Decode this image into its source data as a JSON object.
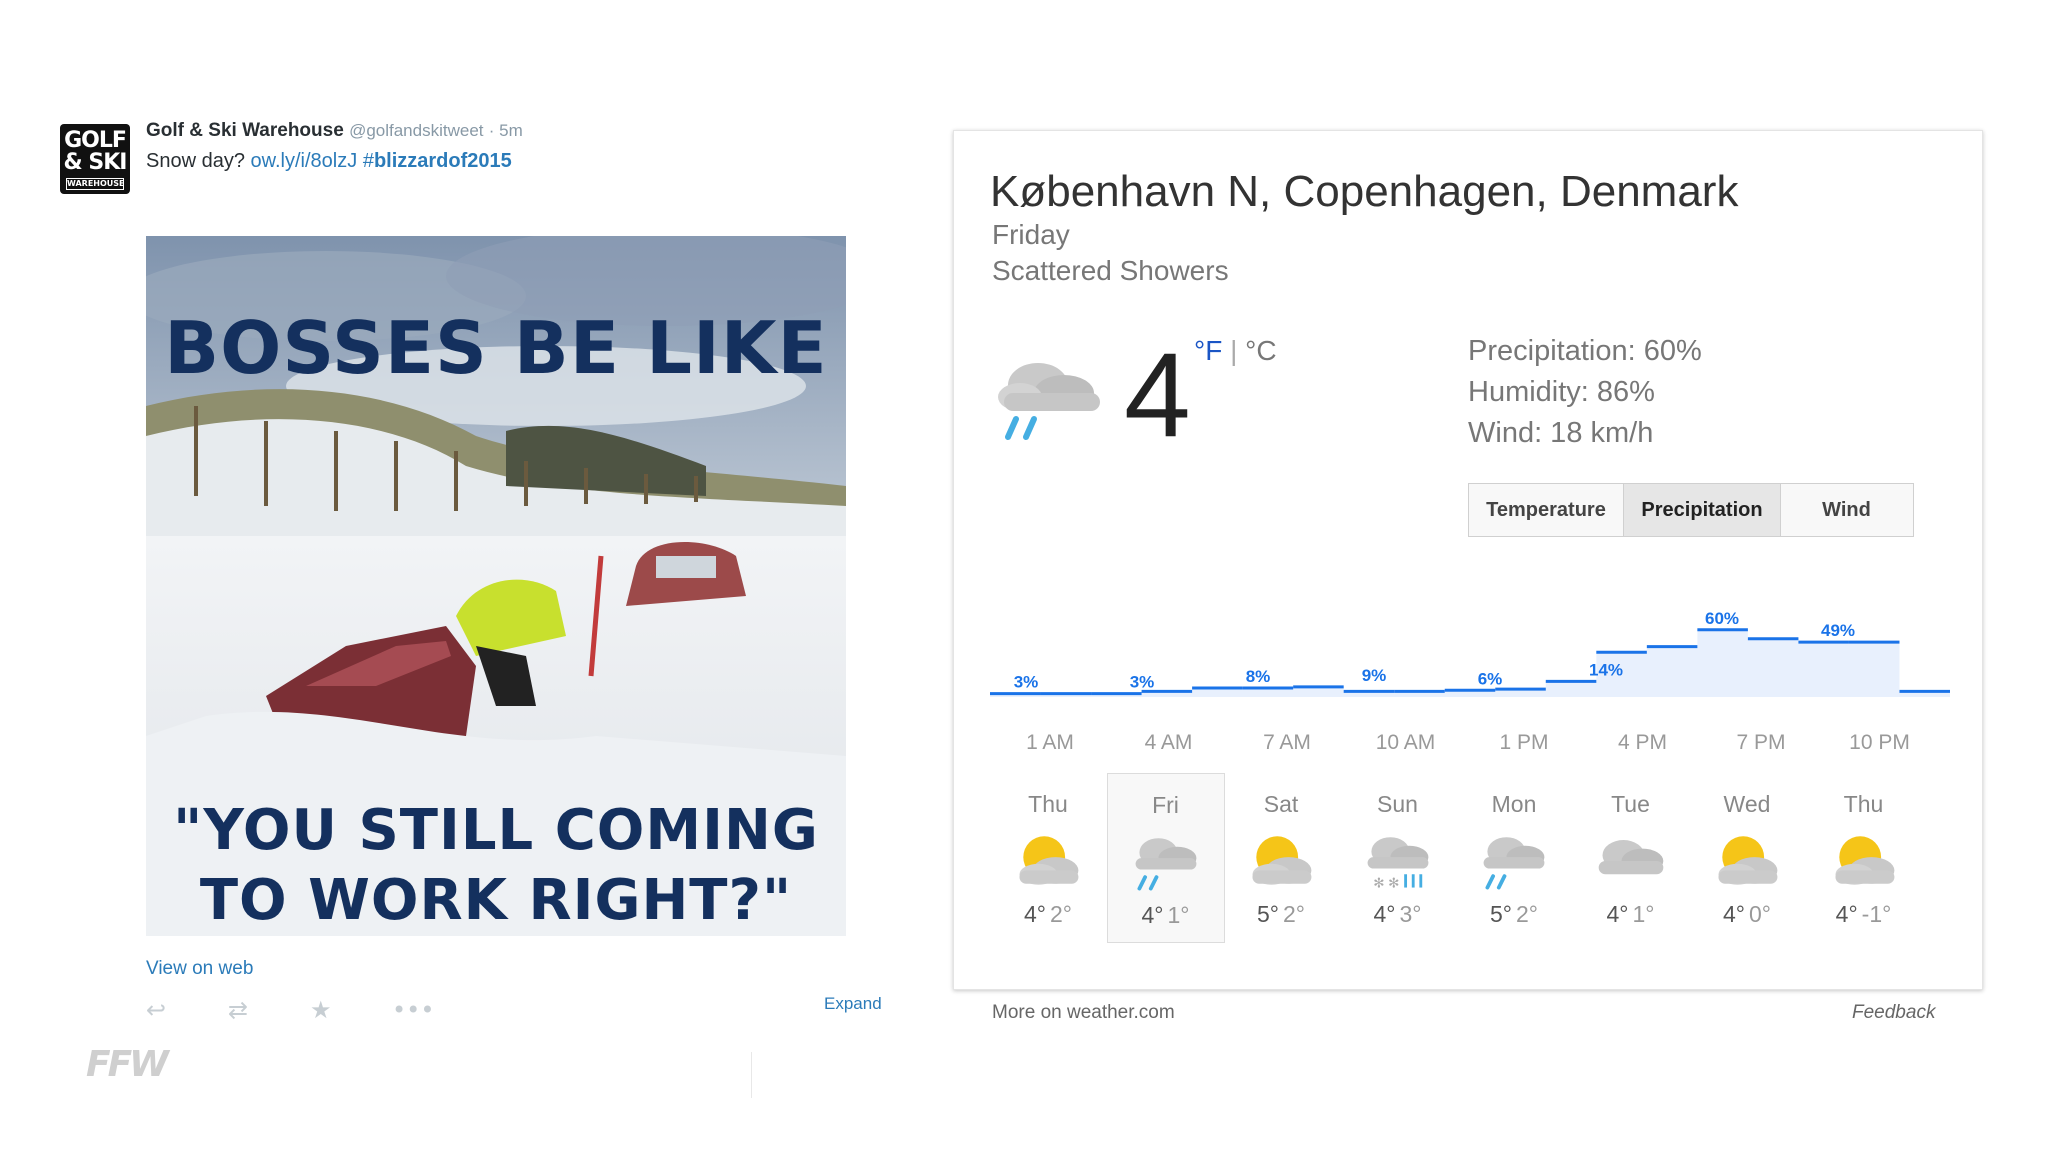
{
  "tweet": {
    "avatar": {
      "line1": "GOLF",
      "line2": "& SKI",
      "line3": "WAREHOUSE"
    },
    "author_name": "Golf & Ski Warehouse",
    "author_handle": "@golfandskitweet",
    "time": "· 5m",
    "text": "Snow day?",
    "link": "ow.ly/i/8olzJ",
    "hashtag_symbol": "#",
    "hashtag": "blizzardof2015",
    "meme_top": "BOSSES BE LIKE",
    "meme_bottom_1": "\"YOU STILL COMING",
    "meme_bottom_2": "TO WORK RIGHT?\"",
    "view_on_web": "View on web",
    "expand": "Expand",
    "actions": {
      "reply": "reply-icon",
      "retweet": "retweet-icon",
      "favorite": "star-icon",
      "more": "more-icon"
    }
  },
  "watermark": "FFW",
  "weather": {
    "location": "København N, Copenhagen, Denmark",
    "day": "Friday",
    "condition": "Scattered Showers",
    "current_temp": "4",
    "unit_f": "°F",
    "unit_sep": " | ",
    "unit_c": "°C",
    "precipitation": "Precipitation: 60%",
    "humidity": "Humidity: 86%",
    "wind": "Wind: 18 km/h",
    "tabs": [
      "Temperature",
      "Precipitation",
      "Wind"
    ],
    "active_tab": "Precipitation",
    "time_labels": [
      "1 AM",
      "4 AM",
      "7 AM",
      "10 AM",
      "1 PM",
      "4 PM",
      "7 PM",
      "10 PM"
    ],
    "forecast": [
      {
        "day": "Thu",
        "icon": "partly-cloudy-icon",
        "hi": "4°",
        "lo": "2°"
      },
      {
        "day": "Fri",
        "icon": "showers-icon",
        "hi": "4°",
        "lo": "1°",
        "selected": true
      },
      {
        "day": "Sat",
        "icon": "partly-cloudy-icon",
        "hi": "5°",
        "lo": "2°"
      },
      {
        "day": "Sun",
        "icon": "snow-rain-icon",
        "hi": "4°",
        "lo": "3°"
      },
      {
        "day": "Mon",
        "icon": "showers-icon",
        "hi": "5°",
        "lo": "2°"
      },
      {
        "day": "Tue",
        "icon": "cloudy-icon",
        "hi": "4°",
        "lo": "1°"
      },
      {
        "day": "Wed",
        "icon": "partly-cloudy-icon",
        "hi": "4°",
        "lo": "0°"
      },
      {
        "day": "Thu",
        "icon": "partly-cloudy-icon",
        "hi": "4°",
        "lo": "-1°"
      }
    ],
    "more_link": "More on weather.com",
    "feedback": "Feedback"
  },
  "chart_data": {
    "type": "area",
    "title": "",
    "x": [
      "1 AM",
      "4 AM",
      "7 AM",
      "10 AM",
      "1 PM",
      "4 PM",
      "7 PM",
      "10 PM"
    ],
    "series": [
      {
        "values": [
          3,
          3,
          8,
          9,
          6,
          14,
          60,
          49
        ],
        "step_values": [
          3,
          3,
          3,
          5,
          8,
          8,
          9,
          5,
          5,
          6,
          7,
          14,
          40,
          45,
          60,
          52,
          49,
          49,
          5
        ]
      }
    ],
    "ylim": [
      0,
      100
    ],
    "accent": "#1a73e8",
    "fill": "#e8f0fd"
  }
}
